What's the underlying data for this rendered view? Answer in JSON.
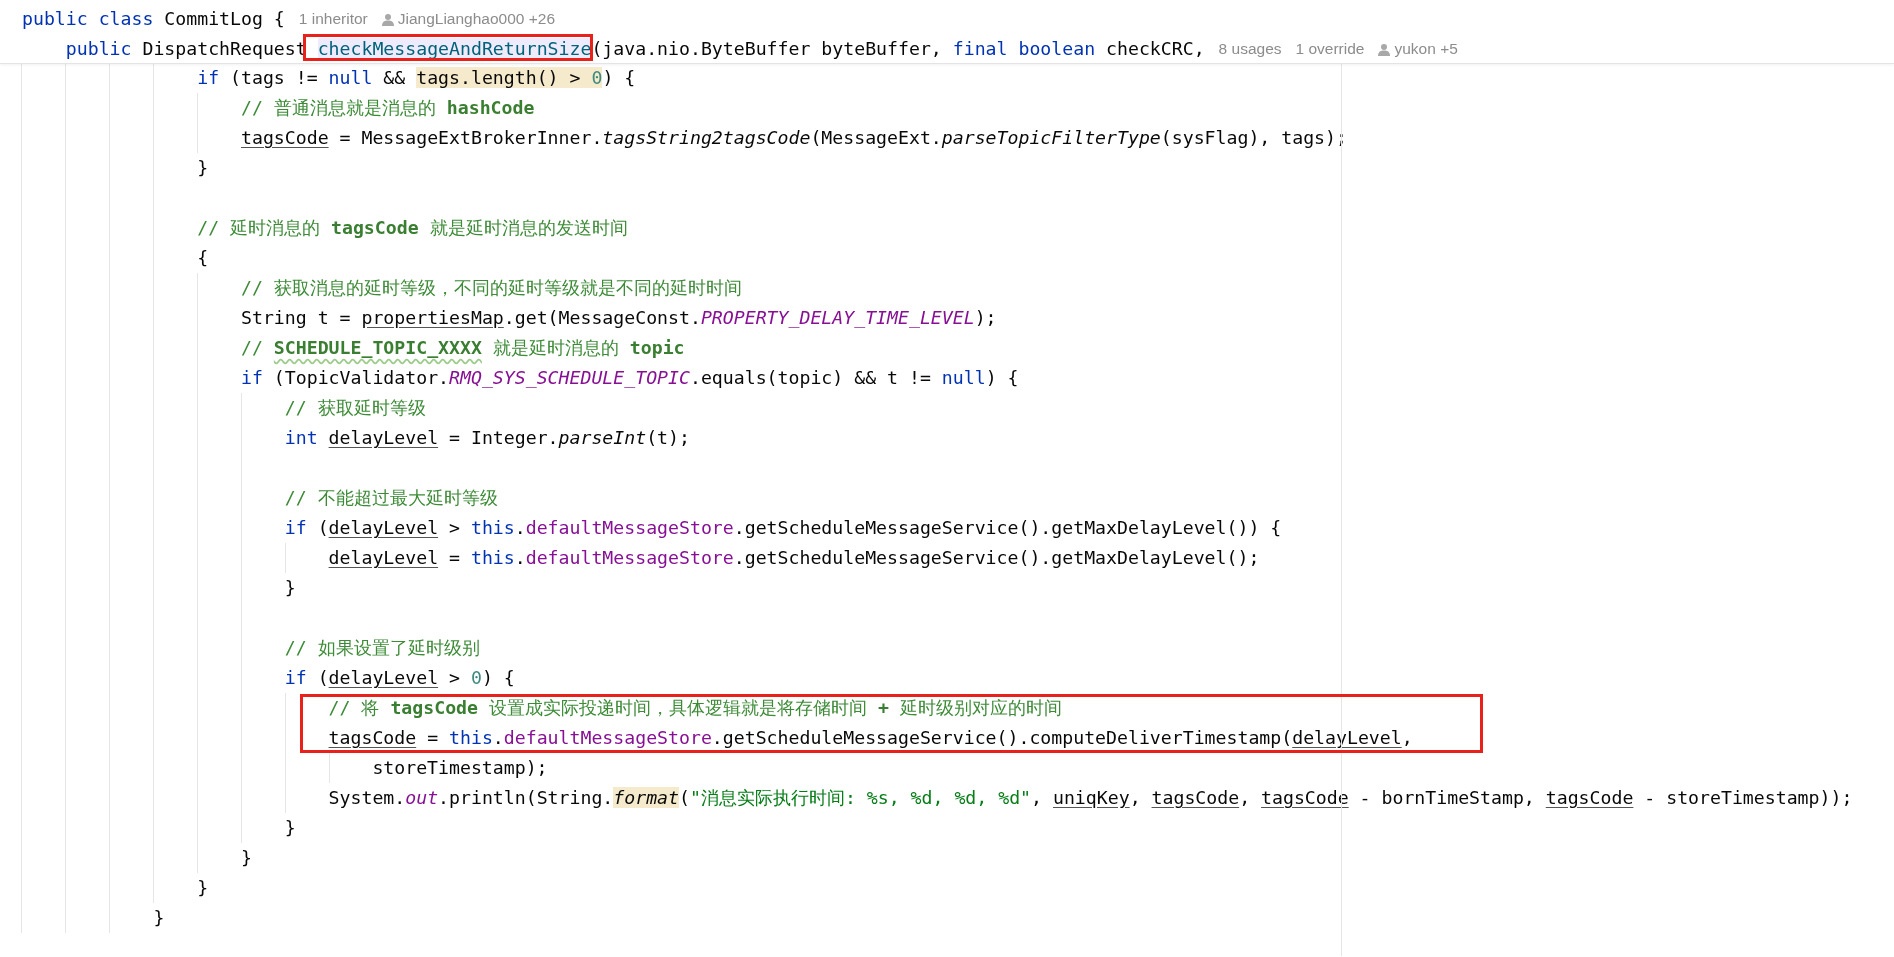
{
  "header": {
    "lines": [
      {
        "kind": "code",
        "tokens": [
          {
            "kind": "kw",
            "text": "public class"
          },
          {
            "kind": "text",
            "text": " CommitLog {"
          }
        ],
        "hints": [
          {
            "kind": "count",
            "text": "1 inheritor"
          },
          {
            "kind": "author",
            "text": "JiangLianghao000 +26"
          }
        ],
        "children": [
          {
            "kind": "code",
            "tokens": [
              {
                "kind": "kw",
                "text": "public"
              },
              {
                "kind": "text",
                "text": " DispatchRequest "
              },
              {
                "kind": "framedecl",
                "text": "checkMessageAndReturnSize"
              },
              {
                "kind": "text",
                "text": "(java.nio.ByteBuffer byteBuffer, "
              },
              {
                "kind": "kw",
                "text": "final boolean"
              },
              {
                "kind": "text",
                "text": " checkCRC,"
              }
            ],
            "hints": [
              {
                "kind": "count",
                "text": "8 usages"
              },
              {
                "kind": "count",
                "text": "1 override"
              },
              {
                "kind": "author",
                "text": "yukon +5"
              }
            ]
          }
        ]
      }
    ]
  },
  "body": {
    "lines": [
      {
        "kind": "block",
        "children": [
          {
            "kind": "code",
            "tokens": [
              {
                "kind": "kw",
                "text": "if"
              },
              {
                "kind": "text",
                "text": " (tags != "
              },
              {
                "kind": "kw",
                "text": "null"
              },
              {
                "kind": "text",
                "text": " && "
              },
              {
                "kind": "mark",
                "text": "tags.length() > "
              },
              {
                "kind": "marknum",
                "text": "0"
              },
              {
                "kind": "text",
                "text": ") {"
              }
            ],
            "children": [
              {
                "kind": "code",
                "tokens": [
                  {
                    "kind": "comment",
                    "text": "// 普通消息就是消息的 "
                  },
                  {
                    "kind": "doc",
                    "text": "hashCode"
                  }
                ]
              },
              {
                "kind": "code",
                "tokens": [
                  {
                    "kind": "var",
                    "text": "tagsCode"
                  },
                  {
                    "kind": "text",
                    "text": " = MessageExtBrokerInner."
                  },
                  {
                    "kind": "ital",
                    "text": "tagsString2tagsCode"
                  },
                  {
                    "kind": "text",
                    "text": "(MessageExt."
                  },
                  {
                    "kind": "ital",
                    "text": "parseTopicFilterType"
                  },
                  {
                    "kind": "text",
                    "text": "(sysFlag), tags);"
                  }
                ]
              }
            ]
          },
          {
            "kind": "code",
            "tokens": [
              {
                "kind": "text",
                "text": "}"
              }
            ]
          },
          {
            "kind": "blank"
          },
          {
            "kind": "code",
            "tokens": [
              {
                "kind": "comment",
                "text": "// 延时消息的 "
              },
              {
                "kind": "doc",
                "text": "tagsCode"
              },
              {
                "kind": "comment",
                "text": " 就是延时消息的发送时间"
              }
            ]
          },
          {
            "kind": "code",
            "tokens": [
              {
                "kind": "text",
                "text": "{"
              }
            ],
            "children": [
              {
                "kind": "code",
                "tokens": [
                  {
                    "kind": "comment",
                    "text": "// 获取消息的延时等级，不同的延时等级就是不同的延时时间"
                  }
                ]
              },
              {
                "kind": "code",
                "tokens": [
                  {
                    "kind": "text",
                    "text": "String t = "
                  },
                  {
                    "kind": "var",
                    "text": "propertiesMap"
                  },
                  {
                    "kind": "text",
                    "text": ".get(MessageConst."
                  },
                  {
                    "kind": "constant",
                    "text": "PROPERTY_DELAY_TIME_LEVEL"
                  },
                  {
                    "kind": "text",
                    "text": ");"
                  }
                ]
              },
              {
                "kind": "code",
                "tokens": [
                  {
                    "kind": "comment",
                    "text": "// "
                  },
                  {
                    "kind": "typo",
                    "text": "SCHEDULE_TOPIC_XXXX"
                  },
                  {
                    "kind": "comment",
                    "text": " 就是延时消息的 "
                  },
                  {
                    "kind": "doc",
                    "text": "topic"
                  }
                ]
              },
              {
                "kind": "code",
                "tokens": [
                  {
                    "kind": "kw",
                    "text": "if"
                  },
                  {
                    "kind": "text",
                    "text": " (TopicValidator."
                  },
                  {
                    "kind": "constant",
                    "text": "RMQ_SYS_SCHEDULE_TOPIC"
                  },
                  {
                    "kind": "text",
                    "text": ".equals(topic) && t != "
                  },
                  {
                    "kind": "kw",
                    "text": "null"
                  },
                  {
                    "kind": "text",
                    "text": ") {"
                  }
                ],
                "children": [
                  {
                    "kind": "code",
                    "tokens": [
                      {
                        "kind": "comment",
                        "text": "// 获取延时等级"
                      }
                    ]
                  },
                  {
                    "kind": "code",
                    "tokens": [
                      {
                        "kind": "kw",
                        "text": "int "
                      },
                      {
                        "kind": "var",
                        "text": "delayLevel"
                      },
                      {
                        "kind": "text",
                        "text": " = Integer."
                      },
                      {
                        "kind": "ital",
                        "text": "parseInt"
                      },
                      {
                        "kind": "text",
                        "text": "(t);"
                      }
                    ]
                  },
                  {
                    "kind": "blank"
                  },
                  {
                    "kind": "code",
                    "tokens": [
                      {
                        "kind": "comment",
                        "text": "// 不能超过最大延时等级"
                      }
                    ]
                  },
                  {
                    "kind": "code",
                    "tokens": [
                      {
                        "kind": "kw",
                        "text": "if"
                      },
                      {
                        "kind": "text",
                        "text": " ("
                      },
                      {
                        "kind": "var",
                        "text": "delayLevel"
                      },
                      {
                        "kind": "text",
                        "text": " > "
                      },
                      {
                        "kind": "kw",
                        "text": "this"
                      },
                      {
                        "kind": "text",
                        "text": "."
                      },
                      {
                        "kind": "field",
                        "text": "defaultMessageStore"
                      },
                      {
                        "kind": "text",
                        "text": ".getScheduleMessageService().getMaxDelayLevel()) {"
                      }
                    ],
                    "children": [
                      {
                        "kind": "code",
                        "tokens": [
                          {
                            "kind": "var",
                            "text": "delayLevel"
                          },
                          {
                            "kind": "text",
                            "text": " = "
                          },
                          {
                            "kind": "kw",
                            "text": "this"
                          },
                          {
                            "kind": "text",
                            "text": "."
                          },
                          {
                            "kind": "field",
                            "text": "defaultMessageStore"
                          },
                          {
                            "kind": "text",
                            "text": ".getScheduleMessageService().getMaxDelayLevel();"
                          }
                        ]
                      }
                    ]
                  },
                  {
                    "kind": "code",
                    "tokens": [
                      {
                        "kind": "text",
                        "text": "}"
                      }
                    ]
                  },
                  {
                    "kind": "blank"
                  },
                  {
                    "kind": "code",
                    "tokens": [
                      {
                        "kind": "comment",
                        "text": "// 如果设置了延时级别"
                      }
                    ]
                  },
                  {
                    "kind": "code",
                    "tokens": [
                      {
                        "kind": "kw",
                        "text": "if"
                      },
                      {
                        "kind": "text",
                        "text": " ("
                      },
                      {
                        "kind": "var",
                        "text": "delayLevel"
                      },
                      {
                        "kind": "text",
                        "text": " > "
                      },
                      {
                        "kind": "num",
                        "text": "0"
                      },
                      {
                        "kind": "text",
                        "text": ") {"
                      }
                    ],
                    "children": [
                      {
                        "kind": "framed",
                        "tokens": [
                          {
                            "kind": "comment",
                            "text": "// 将 "
                          },
                          {
                            "kind": "doc",
                            "text": "tagsCode"
                          },
                          {
                            "kind": "comment",
                            "text": " 设置成实际投递时间，具体逻辑就是将存储时间 "
                          },
                          {
                            "kind": "doc",
                            "text": "+"
                          },
                          {
                            "kind": "comment",
                            "text": " 延时级别对应的时间"
                          }
                        ]
                      },
                      {
                        "kind": "framed",
                        "tokens": [
                          {
                            "kind": "var",
                            "text": "tagsCode"
                          },
                          {
                            "kind": "text",
                            "text": " = "
                          },
                          {
                            "kind": "kw",
                            "text": "this"
                          },
                          {
                            "kind": "text",
                            "text": "."
                          },
                          {
                            "kind": "field",
                            "text": "defaultMessageStore"
                          },
                          {
                            "kind": "text",
                            "text": ".getScheduleMessageService().computeDeliverTimestamp("
                          },
                          {
                            "kind": "var",
                            "text": "delayLevel"
                          },
                          {
                            "kind": "text",
                            "text": ","
                          }
                        ],
                        "children": [
                          {
                            "kind": "code",
                            "tokens": [
                              {
                                "kind": "text",
                                "text": "storeTimestamp);"
                              }
                            ]
                          }
                        ]
                      },
                      {
                        "kind": "code",
                        "tokens": [
                          {
                            "kind": "text",
                            "text": "System."
                          },
                          {
                            "kind": "constant",
                            "text": "out"
                          },
                          {
                            "kind": "text",
                            "text": ".println(String."
                          },
                          {
                            "kind": "markital",
                            "text": "format"
                          },
                          {
                            "kind": "text",
                            "text": "("
                          },
                          {
                            "kind": "str",
                            "text": "\"消息实际执行时间: %s, %d, %d, %d\""
                          },
                          {
                            "kind": "text",
                            "text": ", "
                          },
                          {
                            "kind": "var",
                            "text": "uniqKey"
                          },
                          {
                            "kind": "text",
                            "text": ", "
                          },
                          {
                            "kind": "var",
                            "text": "tagsCode"
                          },
                          {
                            "kind": "text",
                            "text": ", "
                          },
                          {
                            "kind": "var",
                            "text": "tagsCode"
                          },
                          {
                            "kind": "text",
                            "text": " - bornTimeStamp, "
                          },
                          {
                            "kind": "var",
                            "text": "tagsCode"
                          },
                          {
                            "kind": "text",
                            "text": " - storeTimestamp));"
                          }
                        ]
                      }
                    ]
                  },
                  {
                    "kind": "code",
                    "tokens": [
                      {
                        "kind": "text",
                        "text": "}"
                      }
                    ]
                  }
                ]
              },
              {
                "kind": "code",
                "tokens": [
                  {
                    "kind": "text",
                    "text": "}"
                  }
                ]
              }
            ]
          },
          {
            "kind": "code",
            "tokens": [
              {
                "kind": "text",
                "text": "}"
              }
            ]
          }
        ]
      },
      {
        "kind": "code",
        "tokens": [
          {
            "kind": "text",
            "text": "}"
          }
        ]
      }
    ]
  }
}
